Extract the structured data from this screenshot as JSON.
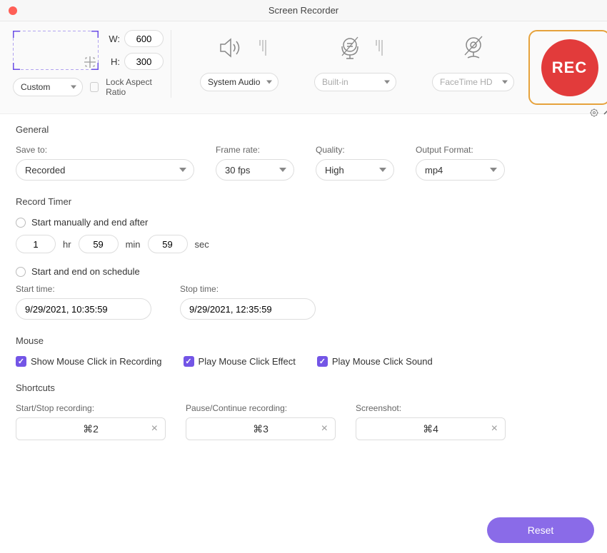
{
  "title": "Screen Recorder",
  "capture": {
    "width_label": "W:",
    "height_label": "H:",
    "width": "600",
    "height": "300",
    "mode": "Custom",
    "lock_label": "Lock Aspect Ratio"
  },
  "audio": {
    "select": "System Audio"
  },
  "mic": {
    "select": "Built-in"
  },
  "webcam": {
    "select": "FaceTime HD"
  },
  "rec_label": "REC",
  "general": {
    "title": "General",
    "save_label": "Save to:",
    "save_value": "Recorded",
    "framerate_label": "Frame rate:",
    "framerate_value": "30 fps",
    "quality_label": "Quality:",
    "quality_value": "High",
    "format_label": "Output Format:",
    "format_value": "mp4"
  },
  "timer": {
    "title": "Record Timer",
    "opt1": "Start manually and end after",
    "hr_value": "1",
    "hr_label": "hr",
    "min_value": "59",
    "min_label": "min",
    "sec_value": "59",
    "sec_label": "sec",
    "opt2": "Start and end on schedule",
    "start_label": "Start time:",
    "start_value": "9/29/2021, 10:35:59",
    "stop_label": "Stop time:",
    "stop_value": "9/29/2021, 12:35:59"
  },
  "mouse": {
    "title": "Mouse",
    "opt1": "Show Mouse Click in Recording",
    "opt2": "Play Mouse Click Effect",
    "opt3": "Play Mouse Click Sound"
  },
  "shortcuts": {
    "title": "Shortcuts",
    "col1_label": "Start/Stop recording:",
    "col1_value": "⌘2",
    "col2_label": "Pause/Continue recording:",
    "col2_value": "⌘3",
    "col3_label": "Screenshot:",
    "col3_value": "⌘4",
    "clear": "×"
  },
  "reset": "Reset"
}
